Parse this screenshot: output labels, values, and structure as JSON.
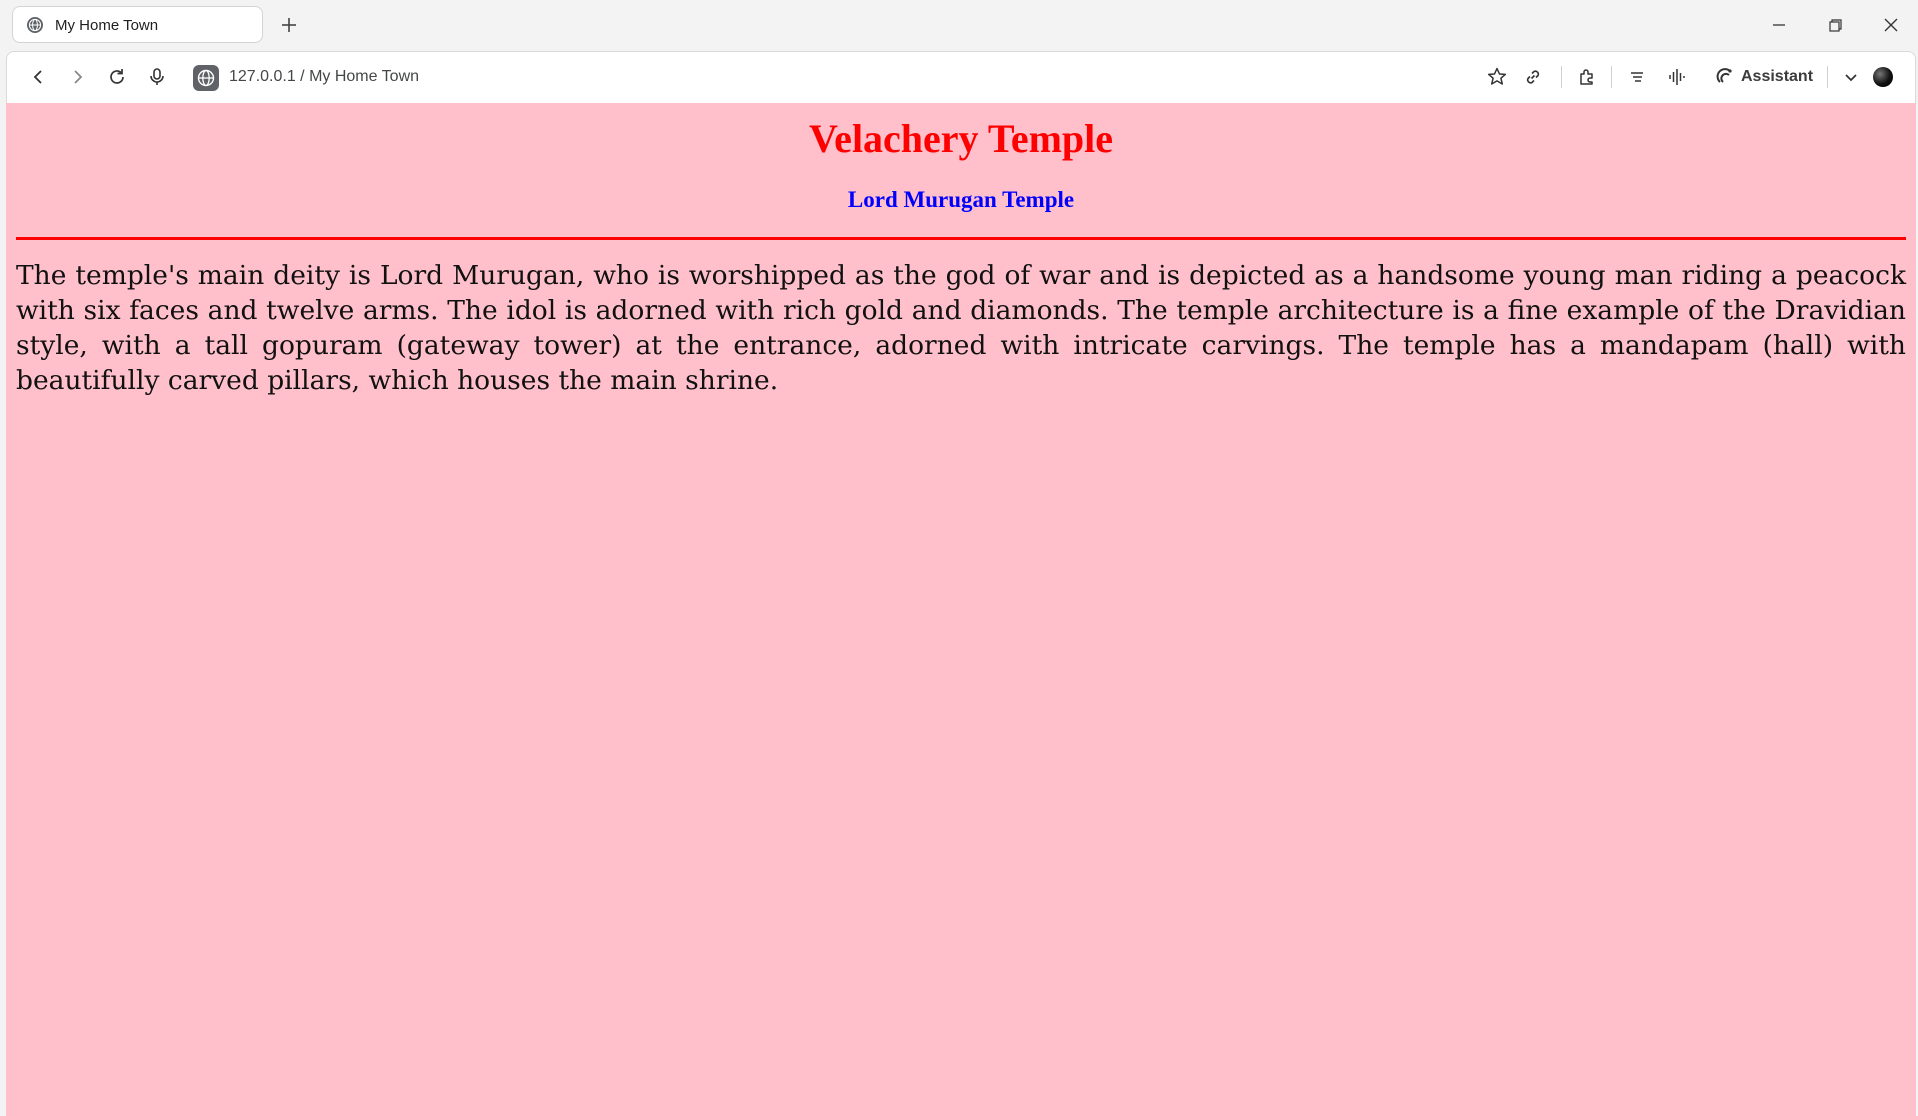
{
  "browser": {
    "tab": {
      "title": "My Home Town",
      "favicon": "globe-icon"
    },
    "new_tab_icon": "plus-icon",
    "address_bar": {
      "url": "127.0.0.1 / My Home Town",
      "site_icon": "globe-icon"
    },
    "assistant_label": "Assistant",
    "toolbar_icons": [
      "back-icon",
      "forward-icon",
      "reload-icon",
      "microphone-icon",
      "star-icon",
      "link-icon",
      "extensions-icon",
      "reading-list-icon",
      "audio-icon",
      "assistant-icon",
      "chevron-down-icon",
      "profile-icon"
    ],
    "window_controls": [
      "minimize-icon",
      "restore-icon",
      "close-icon"
    ]
  },
  "page": {
    "title": "Velachery Temple",
    "subtitle": "Lord Murugan Temple",
    "paragraph": "The temple's main deity is Lord Murugan, who is worshipped as the god of war and is depicted as a handsome young man riding a peacock with six faces and twelve arms. The idol is adorned with rich gold and diamonds. The temple architecture is a fine example of the Dravidian style, with a tall gopuram (gateway tower) at the entrance, adorned with intricate carvings. The temple has a mandapam (hall) with beautifully carved pillars, which houses the main shrine.",
    "colors": {
      "background": "#ffc0cb",
      "title": "#ff0000",
      "subtitle": "#0000ff",
      "rule": "#ff0000"
    }
  }
}
